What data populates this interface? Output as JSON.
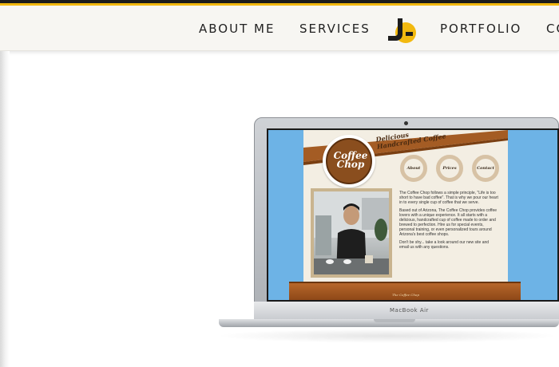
{
  "nav": {
    "items": [
      "ABOUT ME",
      "SERVICES",
      "PORTFOLIO",
      "CO"
    ],
    "logo_text": "JG"
  },
  "laptop": {
    "brand": "MacBook Air"
  },
  "site": {
    "banner_tagline_1": "Delicious",
    "banner_tagline_2": "Handcrafted Coffee",
    "badge_text_1": "Coffee",
    "badge_text_2": "Chop",
    "buttons": [
      "About",
      "Prices",
      "Contact"
    ],
    "paragraphs": [
      "The Coffee Chop follows a simple principle, \"Life is too short to have bad coffee\". That is why we pour our heart in to every single cup of coffee that we serve.",
      "Based out of Arizona, The Coffee Chop provides coffee lovers with a unique experience. It all starts with a delicious, handcrafted cup of coffee made to order and brewed to perfection. Hire us for special events, personal training, or even personalized tours around Arizona's best coffee shops.",
      "Don't be shy... take a look around our new site and email us with any questions."
    ],
    "footer_label": "The Coffee Chop"
  },
  "colors": {
    "accent_yellow": "#f2b90f",
    "coffee_brown": "#8a4e1e",
    "sky_blue": "#6db3e6"
  }
}
